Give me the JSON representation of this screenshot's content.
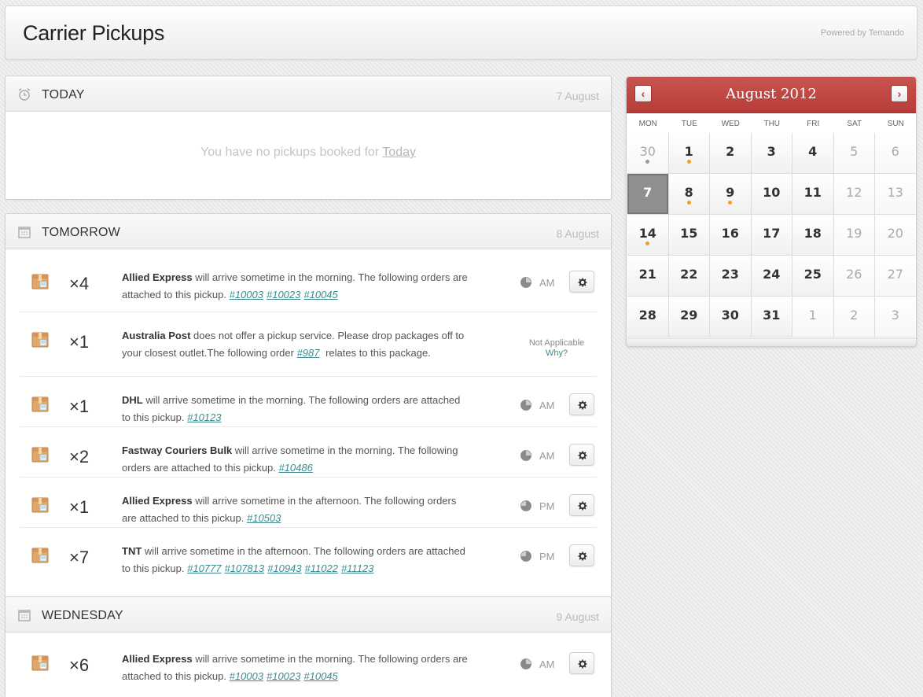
{
  "header": {
    "title": "Carrier Pickups",
    "powered_by": "Powered by Temando"
  },
  "today": {
    "title": "TODAY",
    "date": "7 August",
    "empty_text": "You have no pickups booked for",
    "empty_link": "Today"
  },
  "tomorrow": {
    "title": "TOMORROW",
    "date": "8 August",
    "pickups": [
      {
        "qty": "×4",
        "carrier": "Allied Express",
        "text": " will arrive sometime in the morning. The following orders are attached to this pickup.",
        "orders": [
          "#10003",
          "#10023",
          "#10045"
        ],
        "time": "AM",
        "icon": "morning-clock-icon"
      },
      {
        "qty": "×1",
        "carrier": "Australia Post",
        "text": " does not offer a pickup service. Please drop packages off to your closest outlet.The following order",
        "orders": [
          "#987"
        ],
        "text_after": " relates to this package.",
        "status": "Not Applicable",
        "status_link": "Why?"
      },
      {
        "qty": "×1",
        "carrier": "DHL",
        "text": " will arrive sometime in the morning. The following orders are attached to this pickup.",
        "orders": [
          "#10123"
        ],
        "time": "AM"
      },
      {
        "qty": "×2",
        "carrier": "Fastway Couriers Bulk",
        "text": " will arrive sometime in the morning. The following orders are attached to this pickup.",
        "orders": [
          "#10486"
        ],
        "time": "AM"
      },
      {
        "qty": "×1",
        "carrier": "Allied Express",
        "text": " will arrive sometime in the afternoon. The following orders are attached to this pickup.",
        "orders": [
          "#10503"
        ],
        "time": "PM"
      },
      {
        "qty": "×7",
        "carrier": "TNT",
        "text": " will arrive sometime in the afternoon. The following orders are attached to this pickup.",
        "orders": [
          "#10777",
          "#107813",
          "#10943",
          "#11022",
          "#11123"
        ],
        "time": "PM"
      }
    ]
  },
  "wednesday": {
    "title": "WEDNESDAY",
    "date": "9 August",
    "pickups": [
      {
        "qty": "×6",
        "carrier": "Allied Express",
        "text": " will arrive sometime in the morning. The following orders are attached to this pickup.",
        "orders": [
          "#10003",
          "#10023",
          "#10045"
        ],
        "time": "AM"
      }
    ]
  },
  "calendar": {
    "title": "August 2012",
    "prev_label": "‹",
    "next_label": "›",
    "weekdays": [
      "MON",
      "TUE",
      "WED",
      "THU",
      "FRI",
      "SAT",
      "SUN"
    ],
    "weeks": [
      [
        {
          "d": "30",
          "muted": true,
          "dot": "grey"
        },
        {
          "d": "1",
          "dot": "orange"
        },
        {
          "d": "2"
        },
        {
          "d": "3"
        },
        {
          "d": "4"
        },
        {
          "d": "5",
          "muted": true
        },
        {
          "d": "6",
          "muted": true
        }
      ],
      [
        {
          "d": "7",
          "today": true
        },
        {
          "d": "8",
          "dot": "orange"
        },
        {
          "d": "9",
          "dot": "orange"
        },
        {
          "d": "10"
        },
        {
          "d": "11"
        },
        {
          "d": "12",
          "muted": true
        },
        {
          "d": "13",
          "muted": true
        }
      ],
      [
        {
          "d": "14",
          "dot": "orange"
        },
        {
          "d": "15"
        },
        {
          "d": "16"
        },
        {
          "d": "17"
        },
        {
          "d": "18"
        },
        {
          "d": "19",
          "muted": true
        },
        {
          "d": "20",
          "muted": true
        }
      ],
      [
        {
          "d": "21"
        },
        {
          "d": "22"
        },
        {
          "d": "23"
        },
        {
          "d": "24"
        },
        {
          "d": "25"
        },
        {
          "d": "26",
          "muted": true
        },
        {
          "d": "27",
          "muted": true
        }
      ],
      [
        {
          "d": "28"
        },
        {
          "d": "29"
        },
        {
          "d": "30"
        },
        {
          "d": "31"
        },
        {
          "d": "1",
          "muted": true
        },
        {
          "d": "2",
          "muted": true
        },
        {
          "d": "3",
          "muted": true
        }
      ]
    ],
    "accent_color": "#b63c38",
    "dot_color": "#f0a020"
  }
}
